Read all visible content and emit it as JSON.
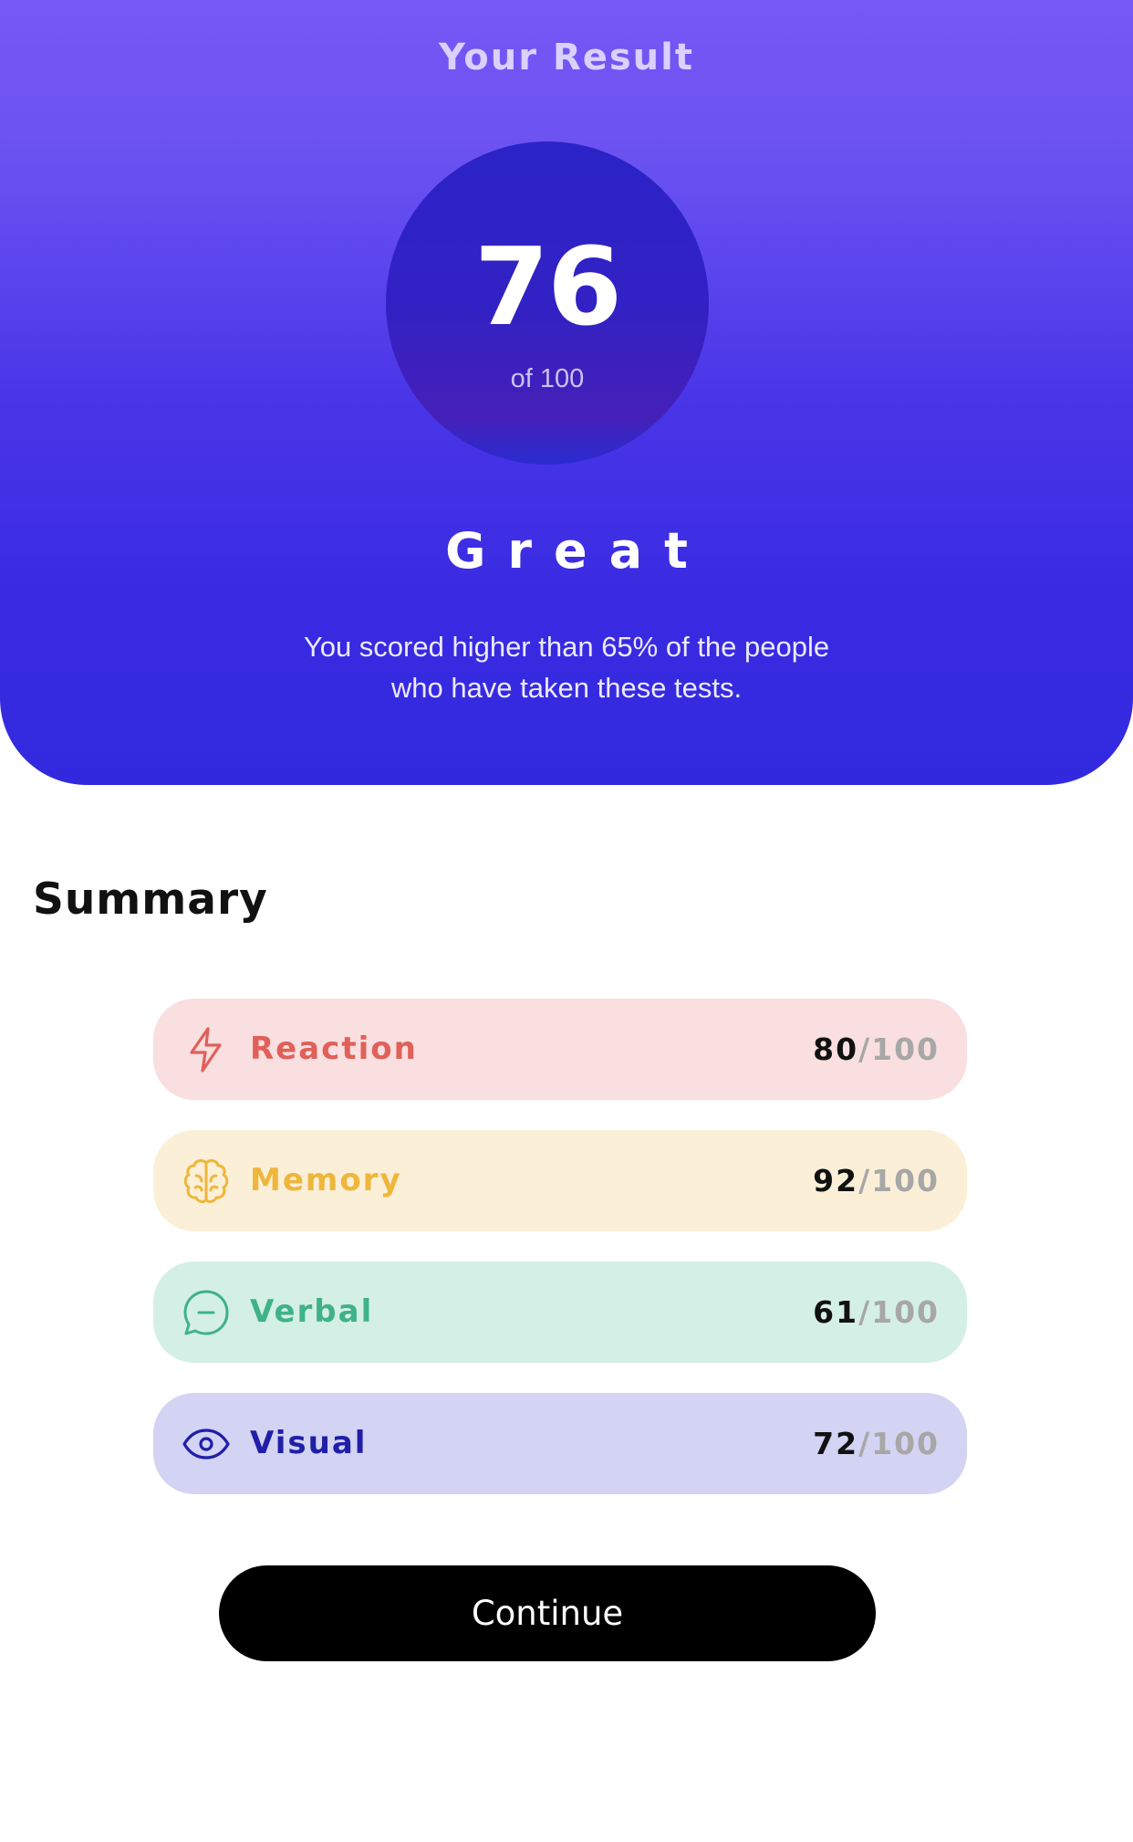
{
  "header": {
    "title": "Your Result",
    "score": "76",
    "score_of": "of 100",
    "grade": "Great",
    "description": "You scored higher than 65% of the people who have taken these tests."
  },
  "summary": {
    "title": "Summary",
    "items": [
      {
        "label": "Reaction",
        "score": "80",
        "max": "/100",
        "icon": "lightning-icon",
        "color": "#e0605a",
        "background": "#f9dfdf"
      },
      {
        "label": "Memory",
        "score": "92",
        "max": "/100",
        "icon": "brain-icon",
        "color": "#eeb63a",
        "background": "#fbefd7"
      },
      {
        "label": "Verbal",
        "score": "61",
        "max": "/100",
        "icon": "chat-bubble-icon",
        "color": "#3fb288",
        "background": "#d4efe6"
      },
      {
        "label": "Visual",
        "score": "72",
        "max": "/100",
        "icon": "eye-icon",
        "color": "#1f1fa8",
        "background": "#d3d3f3"
      }
    ]
  },
  "continue_label": "Continue",
  "colors": {
    "hero_gradient_top": "#7658f5",
    "hero_gradient_bottom": "#3229df",
    "score_circle": "#2b23c7",
    "button": "#000000"
  }
}
